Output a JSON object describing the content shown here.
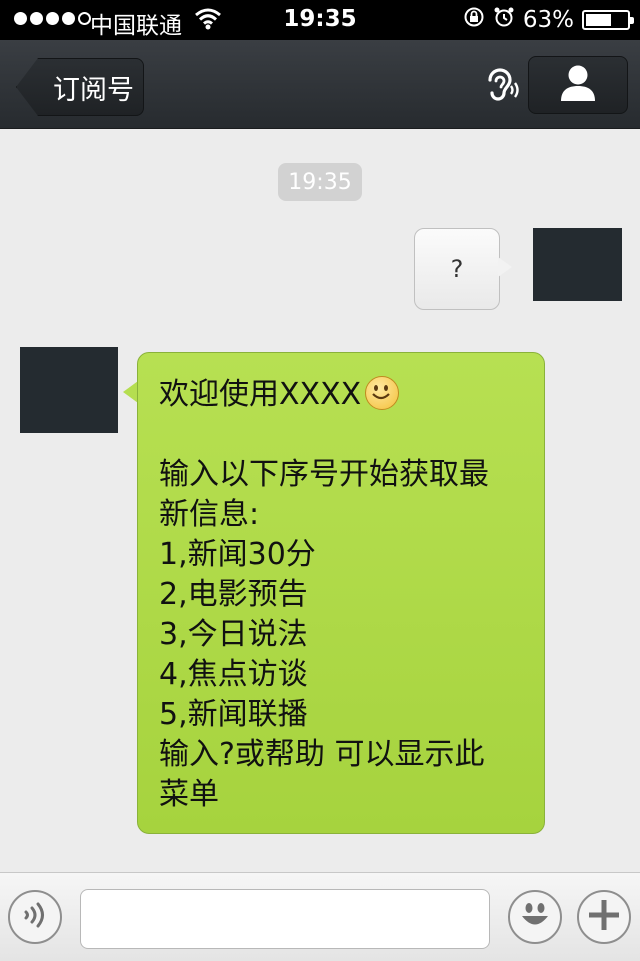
{
  "status_bar": {
    "carrier": "中国联通",
    "time": "19:35",
    "battery": "63%",
    "battery_level": 0.63
  },
  "nav": {
    "back_label": "订阅号"
  },
  "chat": {
    "timestamp": "19:35",
    "outgoing_message": "?",
    "incoming_lines": [
      "欢迎使用XXXX",
      "",
      "输入以下序号开始获取最",
      "新信息:",
      "1,新闻30分",
      "2,电影预告",
      "3,今日说法",
      "4,焦点访谈",
      "5,新闻联播",
      "输入?或帮助 可以显示此",
      "菜单"
    ]
  },
  "input": {
    "value": "",
    "placeholder": ""
  },
  "colors": {
    "incoming_bubble": "#aed945",
    "nav_bar": "#2f3337",
    "avatar": "#242b30"
  }
}
